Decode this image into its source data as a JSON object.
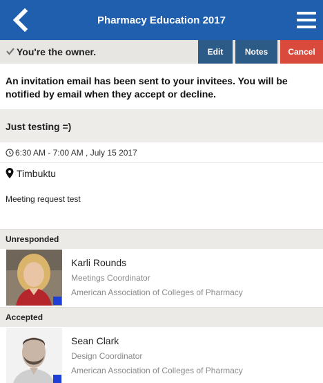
{
  "header": {
    "title": "Pharmacy Education 2017",
    "back_icon": "chevron-left-icon",
    "menu_icon": "hamburger-menu-icon",
    "bg_color": "#1f5fae"
  },
  "owner_bar": {
    "text": "You're the owner.",
    "buttons": {
      "edit": "Edit",
      "notes": "Notes",
      "cancel": "Cancel"
    },
    "colors": {
      "primary": "#2d5b88",
      "danger": "#d94a3d"
    }
  },
  "notice": "An invitation email has been sent to your invitees. You will be notified by email when they accept or decline.",
  "event": {
    "subject": "Just testing =)",
    "time": "6:30 AM - 7:00 AM , July 15 2017",
    "location": "Timbuktu",
    "description": "Meeting request test"
  },
  "sections": {
    "unresponded": {
      "label": "Unresponded",
      "people": [
        {
          "name": "Karli Rounds",
          "title": "Meetings Coordinator",
          "org": "American Association of Colleges of Pharmacy"
        }
      ]
    },
    "accepted": {
      "label": "Accepted",
      "people": [
        {
          "name": "Sean Clark",
          "title": "Design Coordinator",
          "org": "American Association of Colleges of Pharmacy"
        }
      ]
    }
  }
}
